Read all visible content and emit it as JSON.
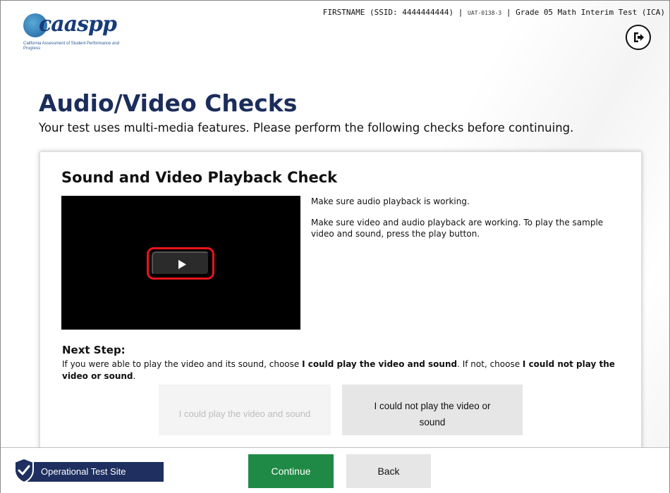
{
  "header": {
    "logo_text": "caaspp",
    "logo_subtitle": "California Assessment of Student Performance and Progress",
    "student": "FIRSTNAME (SSID: 4444444444)",
    "separator": " | ",
    "session_code": "UAT-0138-3",
    "test_name": "Grade 05 Math Interim Test (ICA)",
    "logout_icon": "logout-icon"
  },
  "page": {
    "title": "Audio/Video Checks",
    "subtitle": "Your test uses multi-media features. Please perform the following checks before continuing."
  },
  "check": {
    "title": "Sound and Video Playback Check",
    "info_1": "Make sure audio playback is working.",
    "info_2": "Make sure video and audio playback are working. To play the sample video and sound, press the play button.",
    "play_icon": "play-icon",
    "highlight_color": "#e8141c"
  },
  "next_step": {
    "heading": "Next Step:",
    "text_1": "If you were able to play the video and its sound, choose ",
    "text_2": "I could play the video and sound",
    "text_3": ". If not, choose ",
    "text_4": "I could not play the video or sound",
    "text_5": ".",
    "choice_yes": "I could play the video and sound",
    "choice_no": "I could not play the video or sound"
  },
  "footer": {
    "site_label": "Operational Test Site",
    "shield_icon": "shield-check-icon",
    "continue_label": "Continue",
    "back_label": "Back",
    "continue_color": "#1f8a45",
    "site_badge_color": "#1e2f60"
  }
}
